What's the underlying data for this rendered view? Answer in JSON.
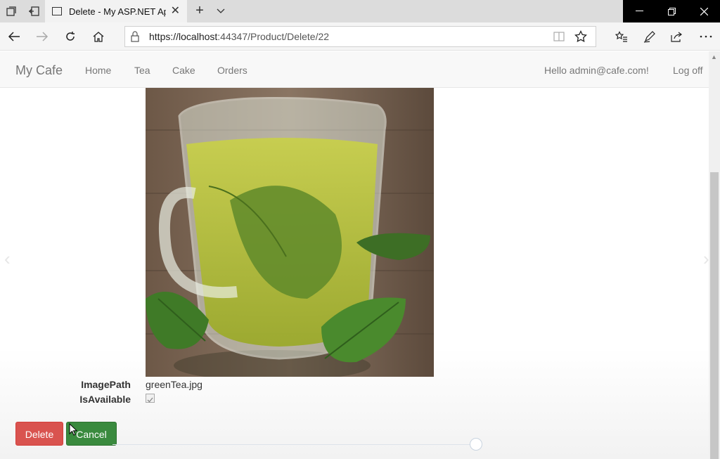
{
  "browser": {
    "tab_title": "Delete - My ASP.NET Ap",
    "url_host": "https://localhost",
    "url_rest": ":44347/Product/Delete/22"
  },
  "site": {
    "brand": "My Cafe",
    "nav": [
      "Home",
      "Tea",
      "Cake",
      "Orders"
    ],
    "greeting": "Hello admin@cafe.com!",
    "logoff": "Log off"
  },
  "details": {
    "image_path_label": "ImagePath",
    "image_path_value": "greenTea.jpg",
    "is_available_label": "IsAvailable",
    "is_available": true
  },
  "actions": {
    "delete": "Delete",
    "cancel": "Cancel"
  },
  "colors": {
    "delete_button": "#d9534f",
    "cancel_button": "#3a8a3e"
  },
  "icons": {
    "tab_actions": [
      "tab-sets-icon",
      "set-aside-tabs-icon",
      "page-icon",
      "close-icon",
      "plus-icon",
      "chevron-down-icon"
    ],
    "nav": [
      "back-arrow-icon",
      "forward-arrow-icon",
      "refresh-icon",
      "home-icon",
      "lock-icon",
      "reading-view-icon",
      "favorite-star-icon",
      "favorites-list-icon",
      "pen-icon",
      "share-icon",
      "more-icon"
    ]
  }
}
